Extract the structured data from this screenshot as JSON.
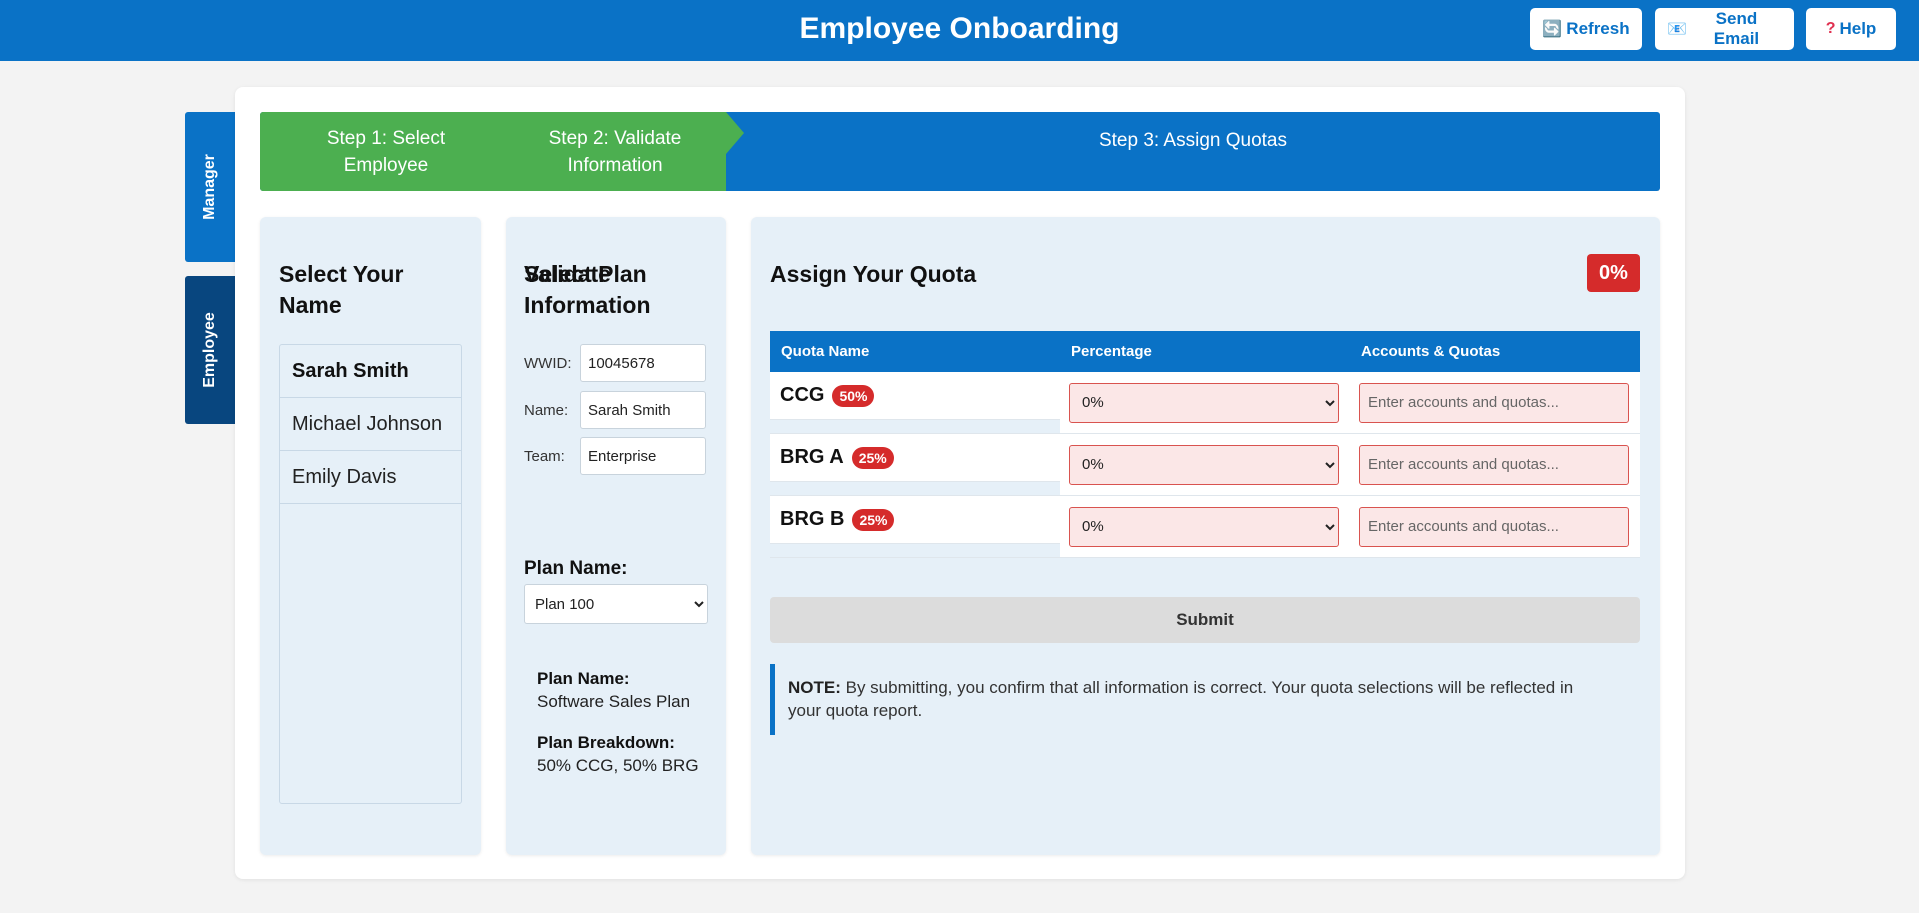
{
  "header": {
    "title": "Employee Onboarding",
    "refresh_label": "Refresh",
    "email_label": "Send Email",
    "help_label": "Help",
    "help_icon": "?"
  },
  "side_tabs": {
    "manager": "Manager",
    "employee": "Employee"
  },
  "steps": [
    {
      "label": "Step 1: Select Employee",
      "state": "done"
    },
    {
      "label": "Step 2: Validate Information",
      "state": "done"
    },
    {
      "label": "Step 3: Assign Quotas",
      "state": "active"
    }
  ],
  "select_panel": {
    "title": "Select Your Name",
    "names": [
      "Sarah Smith",
      "Michael Johnson",
      "Emily Davis"
    ],
    "selected": "Sarah Smith"
  },
  "validate_panel": {
    "title": "Validate Information",
    "wwid_label": "WWID:",
    "wwid_value": "10045678",
    "name_label": "Name:",
    "name_value": "Sarah Smith",
    "team_label": "Team:",
    "team_value": "Enterprise",
    "select_plan_title": "Select Plan",
    "plan_name_label": "Plan Name:",
    "plan_selected": "Plan 100",
    "detail_name_label": "Plan Name:",
    "detail_name_value": "Software Sales Plan",
    "detail_breakdown_label": "Plan Breakdown:",
    "detail_breakdown_value": "50% CCG, 50% BRG"
  },
  "quota_panel": {
    "title": "Assign Your Quota",
    "total_badge": "0%",
    "columns": [
      "Quota Name",
      "Percentage",
      "Accounts & Quotas"
    ],
    "rows": [
      {
        "name": "CCG",
        "tag": "50%",
        "percentage": "0%",
        "placeholder": "Enter accounts and quotas..."
      },
      {
        "name": "BRG A",
        "tag": "25%",
        "percentage": "0%",
        "placeholder": "Enter accounts and quotas..."
      },
      {
        "name": "BRG B",
        "tag": "25%",
        "percentage": "0%",
        "placeholder": "Enter accounts and quotas..."
      }
    ],
    "submit_label": "Submit",
    "note_bold": "NOTE:",
    "note_text": "By submitting, you confirm that all information is correct. Your quota selections will be reflected in your quota report."
  },
  "colors": {
    "primary": "#0a72c6",
    "success": "#4caf50",
    "danger": "#d52b2b",
    "panel_bg": "#e6f0f8"
  }
}
